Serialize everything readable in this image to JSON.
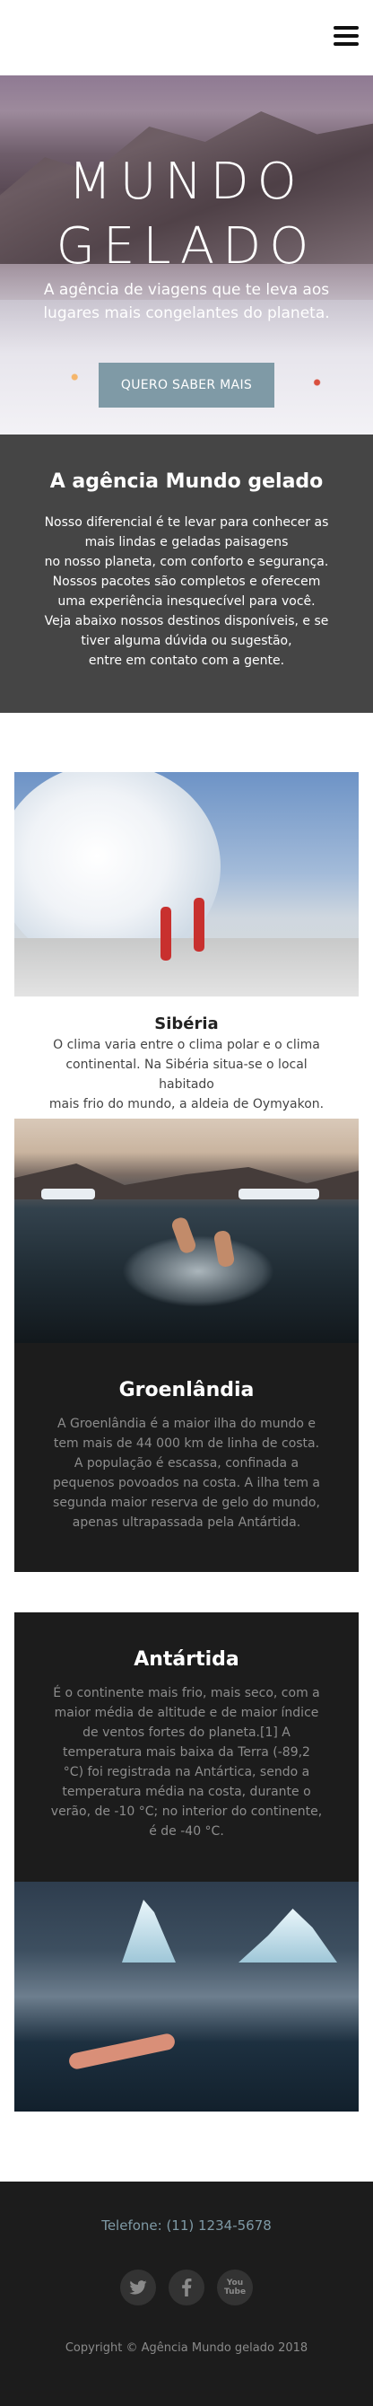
{
  "header": {
    "menu_icon": "hamburger-menu-icon"
  },
  "hero": {
    "title_line1": "MUNDO",
    "title_line2": "GELADO",
    "subtitle": "A agência de viagens que te leva aos lugares mais congelantes do planeta.",
    "button_label": "QUERO SABER MAIS",
    "button_color": "#7f9aa6"
  },
  "about": {
    "heading": "A agência Mundo gelado",
    "text": "Nosso diferencial é te levar para conhecer as\nmais lindas e geladas paisagens\nno nosso planeta, com conforto e segurança.\nNossos pacotes são completos e oferecem\numa experiência inesquecível para você.\nVeja abaixo nossos destinos disponíveis, e se\ntiver alguma dúvida ou sugestão,\nentre em contato com a gente."
  },
  "destinations": [
    {
      "title": "Sibéria",
      "text": "O clima varia entre o clima polar e o clima\ncontinental. Na Sibéria situa-se o local habitado\nmais frio do mundo, a aldeia de Oymyakon."
    },
    {
      "title": "Groenlândia",
      "text": "A Groenlândia é a maior ilha do mundo e\ntem mais de 44 000 km de linha de costa.\nA população é escassa, confinada a\npequenos povoados na costa. A ilha tem a\nsegunda maior reserva de gelo do mundo,\napenas ultrapassada pela Antártida."
    },
    {
      "title": "Antártida",
      "text": "É o continente mais frio, mais seco, com a\nmaior média de altitude e de maior índice\nde ventos fortes do planeta.[1] A\ntemperatura mais baixa da Terra (-89,2\n°C) foi registrada na Antártica, sendo a\ntemperatura média na costa, durante o\nverão, de -10 °C; no interior do continente,\né de -40 °C."
    }
  ],
  "footer": {
    "phone": "Telefone: (11) 1234-5678",
    "social": [
      "twitter-icon",
      "facebook-icon",
      "youtube-icon"
    ],
    "youtube_text_top": "You",
    "youtube_text_bottom": "Tube",
    "copyright": "Copyright © Agência Mundo gelado 2018"
  }
}
